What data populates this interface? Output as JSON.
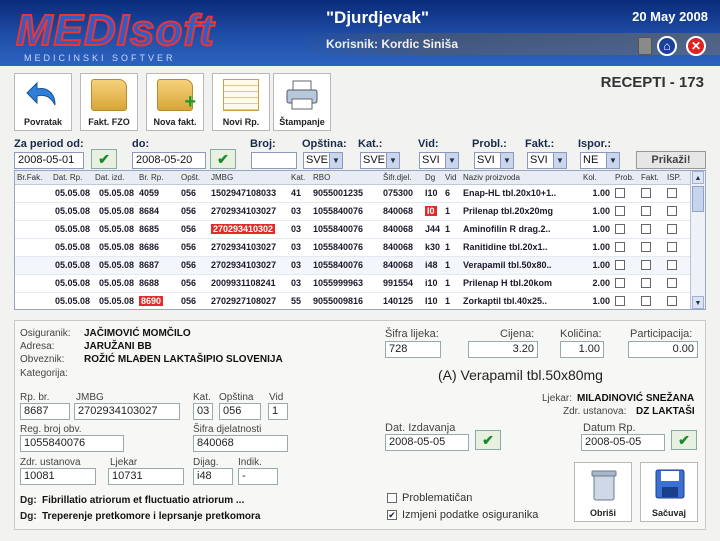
{
  "header": {
    "logo_text": "MEDIsoft",
    "logo_sub": "MEDICINSKI SOFTVER",
    "title": "\"Djurdjevak\"",
    "date": "20 May 2008",
    "user": "Korisnik: Kordic Siniša"
  },
  "page_title": "RECEPTI - 173",
  "toolbar": [
    {
      "label": "Povratak",
      "icon": "back-arrow-icon"
    },
    {
      "label": "Fakt. FZO",
      "icon": "folder-icon"
    },
    {
      "label": "Nova fakt.",
      "icon": "folder-add-icon"
    },
    {
      "label": "Novi Rp.",
      "icon": "notepad-icon"
    },
    {
      "label": "Štampanje",
      "icon": "printer-icon"
    }
  ],
  "filters": {
    "period_label": "Za period od:",
    "from": "2008-05-01",
    "to_label": "do:",
    "to": "2008-05-20",
    "broj_label": "Broj:",
    "broj": "",
    "opstina_label": "Opština:",
    "opstina": "SVE",
    "kat_label": "Kat.:",
    "kat": "SVE",
    "vid_label": "Vid:",
    "vid": "SVI",
    "probl_label": "Probl.:",
    "probl": "SVI",
    "fakt_label": "Fakt.:",
    "fakt": "SVI",
    "ispor_label": "Ispor.:",
    "ispor": "NE",
    "show_button": "Prikaži!"
  },
  "grid": {
    "columns": [
      "Br.Fak.",
      "Dat. Rp.",
      "Dat. izd.",
      "Br. Rp.",
      "Opšt.",
      "JMBG",
      "Kat.",
      "RBO",
      "Šifr.djel.",
      "Dg",
      "Vid",
      "Naziv proizvoda",
      "Kol.",
      "Prob.",
      "Fakt.",
      "ISP."
    ],
    "rows": [
      {
        "br_fak": "",
        "dat_rp": "05.05.08",
        "dat_izd": "05.05.08",
        "br_rp": "4059",
        "opst": "056",
        "jmbg": "1502947108033",
        "kat": "41",
        "rbo": "9055001235",
        "sifr": "075300",
        "dg": "I10",
        "vid": "6",
        "naziv": "Enap-HL tbl.20x10+1..",
        "kol": "1.00"
      },
      {
        "br_fak": "",
        "dat_rp": "05.05.08",
        "dat_izd": "05.05.08",
        "br_rp": "8684",
        "opst": "056",
        "jmbg": "2702934103027",
        "kat": "03",
        "rbo": "1055840076",
        "sifr": "840068",
        "dg": "I0",
        "vid": "1",
        "naziv": "Prilenap tbl.20x20mg",
        "kol": "1.00",
        "red": [
          "dg"
        ]
      },
      {
        "br_fak": "",
        "dat_rp": "05.05.08",
        "dat_izd": "05.05.08",
        "br_rp": "8685",
        "opst": "056",
        "jmbg": "270293410302",
        "kat": "03",
        "rbo": "1055840076",
        "sifr": "840068",
        "dg": "J44",
        "vid": "1",
        "naziv": "Aminofilin R drag.2..",
        "kol": "1.00",
        "red": [
          "jmbg"
        ]
      },
      {
        "br_fak": "",
        "dat_rp": "05.05.08",
        "dat_izd": "05.05.08",
        "br_rp": "8686",
        "opst": "056",
        "jmbg": "2702934103027",
        "kat": "03",
        "rbo": "1055840076",
        "sifr": "840068",
        "dg": "k30",
        "vid": "1",
        "naziv": "Ranitidine tbl.20x1..",
        "kol": "1.00"
      },
      {
        "br_fak": "",
        "dat_rp": "05.05.08",
        "dat_izd": "05.05.08",
        "br_rp": "8687",
        "opst": "056",
        "jmbg": "2702934103027",
        "kat": "03",
        "rbo": "1055840076",
        "sifr": "840068",
        "dg": "i48",
        "vid": "1",
        "naziv": "Verapamil tbl.50x80..",
        "kol": "1.00",
        "selected": true
      },
      {
        "br_fak": "",
        "dat_rp": "05.05.08",
        "dat_izd": "05.05.08",
        "br_rp": "8688",
        "opst": "056",
        "jmbg": "2009931108241",
        "kat": "03",
        "rbo": "1055999963",
        "sifr": "991554",
        "dg": "i10",
        "vid": "1",
        "naziv": "Prilenap H tbl.20kom",
        "kol": "2.00"
      },
      {
        "br_fak": "",
        "dat_rp": "05.05.08",
        "dat_izd": "05.05.08",
        "br_rp": "8690",
        "opst": "056",
        "jmbg": "2702927108027",
        "kat": "55",
        "rbo": "9055009816",
        "sifr": "140125",
        "dg": "I10",
        "vid": "1",
        "naziv": "Zorkaptil tbl.40x25..",
        "kol": "1.00",
        "red": [
          "br_rp"
        ]
      },
      {
        "br_fak": "",
        "dat_rp": "05.05.08",
        "dat_izd": "05.05.08",
        "br_rp": "8690",
        "opst": "056",
        "jmbg": "2009931108241",
        "kat": "10",
        "rbo": "1055999963",
        "sifr": "991554",
        "dg": "i10",
        "vid": "1",
        "naziv": "Ranital tbl.20x150..",
        "kol": "1.00",
        "red": [
          "br_rp",
          "kat"
        ]
      }
    ]
  },
  "detail": {
    "osiguranik_label": "Osiguranik:",
    "osiguranik": "JAČIMOVIĆ MOMČILO",
    "adresa_label": "Adresa:",
    "adresa": "JARUŽANI BB",
    "obveznik_label": "Obveznik:",
    "obveznik": "ROŽIĆ MLAĐEN LAKTAŠIPIO SLOVENIJA",
    "kategorija_label": "Kategorija:",
    "rp_br_label": "Rp. br.",
    "rp_br": "8687",
    "jmbg_label": "JMBG",
    "jmbg": "2702934103027",
    "kat_label": "Kat.",
    "kat": "03",
    "opstina_label": "Opština",
    "opstina": "056",
    "vid_label": "Vid",
    "vid": "1",
    "reg_label": "Reg. broj obv.",
    "reg": "1055840076",
    "sifra_dj_label": "Šifra djelatnosti",
    "sifra_dj": "840068",
    "zdr_label": "Zdr. ustanova",
    "zdr": "10081",
    "ljekar_label": "Ljekar",
    "ljekar": "10731",
    "dijag_label": "Dijag.",
    "dijag": "i48",
    "indik_label": "Indik.",
    "indik": "-",
    "dg_label": "Dg:",
    "dg1": "Fibrillatio atriorum et fluctuatio atriorum ...",
    "dg2": "Treperenje pretkomore i leprsanje pretkomora",
    "sifra_lijeka_label": "Šifra lijeka:",
    "sifra_lijeka": "728",
    "cijena_label": "Cijena:",
    "cijena": "3.20",
    "kolicina_label": "Količina:",
    "kolicina": "1.00",
    "particip_label": "Participacija:",
    "particip": "0.00",
    "drug": "(A)   Verapamil tbl.50x80mg",
    "ljekar_name_label": "Ljekar:",
    "ljekar_name": "MILADINOVIĆ SNEŽANA",
    "zdr_ust_label": "Zdr. ustanova:",
    "zdr_ust": "DZ LAKTAŠI",
    "dat_izd_label": "Dat. Izdavanja",
    "dat_izd": "2008-05-05",
    "datum_rp_label": "Datum Rp.",
    "datum_rp": "2008-05-05",
    "problematican_label": "Problematičan",
    "izmjeni_label": "Izmjeni podatke osiguranika",
    "obrisi": "Obriši",
    "sacuvaj": "Sačuvaj"
  }
}
